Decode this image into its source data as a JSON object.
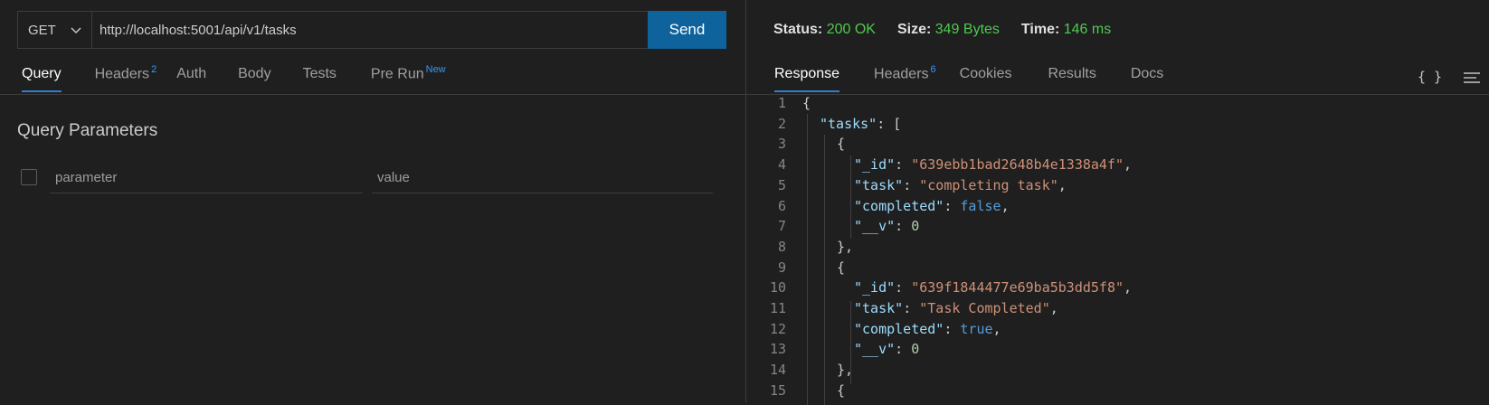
{
  "request": {
    "method": "GET",
    "url": "http://localhost:5001/api/v1/tasks",
    "send_label": "Send"
  },
  "request_tabs": [
    {
      "label": "Query",
      "badge": ""
    },
    {
      "label": "Headers",
      "badge": "2"
    },
    {
      "label": "Auth",
      "badge": ""
    },
    {
      "label": "Body",
      "badge": ""
    },
    {
      "label": "Tests",
      "badge": ""
    },
    {
      "label": "Pre Run",
      "badge": "New"
    }
  ],
  "query": {
    "title": "Query Parameters",
    "param_placeholder": "parameter",
    "value_placeholder": "value"
  },
  "status": {
    "status_label": "Status:",
    "status_value": "200 OK",
    "size_label": "Size:",
    "size_value": "349 Bytes",
    "time_label": "Time:",
    "time_value": "146 ms"
  },
  "response_tabs": [
    {
      "label": "Response",
      "badge": ""
    },
    {
      "label": "Headers",
      "badge": "6"
    },
    {
      "label": "Cookies",
      "badge": ""
    },
    {
      "label": "Results",
      "badge": ""
    },
    {
      "label": "Docs",
      "badge": ""
    }
  ],
  "toolbar": {
    "format_icon": "braces-icon",
    "menu_icon": "wrap-lines-icon"
  },
  "colors": {
    "accent": "#0e639c",
    "status_ok": "#4ec94e",
    "badge": "#3794ff"
  },
  "code_lines": [
    {
      "n": "1",
      "indent": 0,
      "tokens": [
        [
          "p",
          "{"
        ]
      ]
    },
    {
      "n": "2",
      "indent": 1,
      "tokens": [
        [
          "k",
          "\"tasks\""
        ],
        [
          "p",
          ": ["
        ]
      ]
    },
    {
      "n": "3",
      "indent": 2,
      "tokens": [
        [
          "p",
          "{"
        ]
      ]
    },
    {
      "n": "4",
      "indent": 3,
      "tokens": [
        [
          "k",
          "\"_id\""
        ],
        [
          "p",
          ": "
        ],
        [
          "s",
          "\"639ebb1bad2648b4e1338a4f\""
        ],
        [
          "p",
          ","
        ]
      ]
    },
    {
      "n": "5",
      "indent": 3,
      "tokens": [
        [
          "k",
          "\"task\""
        ],
        [
          "p",
          ": "
        ],
        [
          "s",
          "\"completing task\""
        ],
        [
          "p",
          ","
        ]
      ]
    },
    {
      "n": "6",
      "indent": 3,
      "tokens": [
        [
          "k",
          "\"completed\""
        ],
        [
          "p",
          ": "
        ],
        [
          "b",
          "false"
        ],
        [
          "p",
          ","
        ]
      ]
    },
    {
      "n": "7",
      "indent": 3,
      "tokens": [
        [
          "k",
          "\"__v\""
        ],
        [
          "p",
          ": "
        ],
        [
          "n",
          "0"
        ]
      ]
    },
    {
      "n": "8",
      "indent": 2,
      "tokens": [
        [
          "p",
          "},"
        ]
      ]
    },
    {
      "n": "9",
      "indent": 2,
      "tokens": [
        [
          "p",
          "{"
        ]
      ]
    },
    {
      "n": "10",
      "indent": 3,
      "tokens": [
        [
          "k",
          "\"_id\""
        ],
        [
          "p",
          ": "
        ],
        [
          "s",
          "\"639f1844477e69ba5b3dd5f8\""
        ],
        [
          "p",
          ","
        ]
      ]
    },
    {
      "n": "11",
      "indent": 3,
      "tokens": [
        [
          "k",
          "\"task\""
        ],
        [
          "p",
          ": "
        ],
        [
          "s",
          "\"Task Completed\""
        ],
        [
          "p",
          ","
        ]
      ]
    },
    {
      "n": "12",
      "indent": 3,
      "tokens": [
        [
          "k",
          "\"completed\""
        ],
        [
          "p",
          ": "
        ],
        [
          "b",
          "true"
        ],
        [
          "p",
          ","
        ]
      ]
    },
    {
      "n": "13",
      "indent": 3,
      "tokens": [
        [
          "k",
          "\"__v\""
        ],
        [
          "p",
          ": "
        ],
        [
          "n",
          "0"
        ]
      ]
    },
    {
      "n": "14",
      "indent": 2,
      "tokens": [
        [
          "p",
          "},"
        ]
      ]
    },
    {
      "n": "15",
      "indent": 2,
      "tokens": [
        [
          "p",
          "{"
        ]
      ]
    }
  ]
}
